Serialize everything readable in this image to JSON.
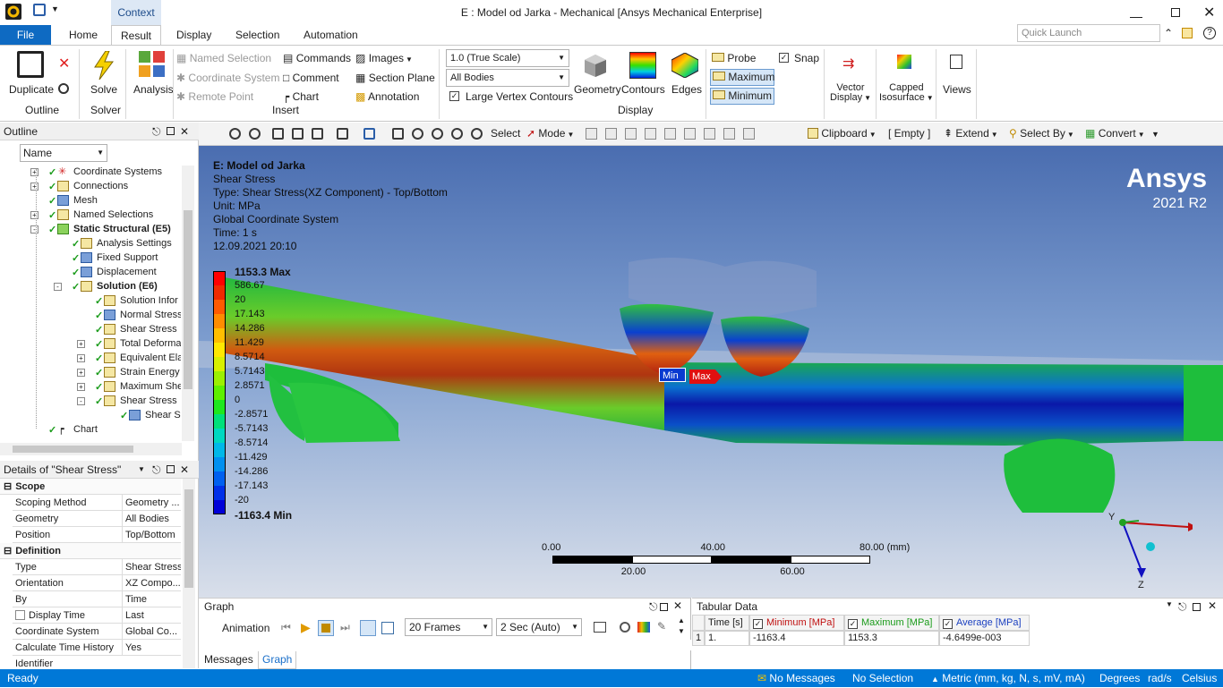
{
  "window": {
    "title": "E : Model od Jarka - Mechanical [Ansys Mechanical Enterprise]"
  },
  "context_label": "Context",
  "tabs": {
    "file": "File",
    "home": "Home",
    "result": "Result",
    "display": "Display",
    "selection": "Selection",
    "automation": "Automation"
  },
  "quick_launch": {
    "placeholder": "Quick Launch"
  },
  "ribbon": {
    "duplicate": "Duplicate",
    "outline_group": "Outline",
    "solve": "Solve",
    "solver_group": "Solver",
    "analysis": "Analysis",
    "named_selection": "Named Selection",
    "coordinate_system": "Coordinate System",
    "remote_point": "Remote Point",
    "commands": "Commands",
    "comment": "Comment",
    "chart": "Chart",
    "images": "Images",
    "section_plane": "Section Plane",
    "annotation": "Annotation",
    "insert_group": "Insert",
    "scale_select": "1.0 (True Scale)",
    "bodies_select": "All Bodies",
    "large_vertex": "Large Vertex Contours",
    "geometry": "Geometry",
    "contours": "Contours",
    "edges": "Edges",
    "display_group": "Display",
    "probe": "Probe",
    "maximum": "Maximum",
    "minimum": "Minimum",
    "snap": "Snap",
    "vector_display_1": "Vector",
    "vector_display_2": "Display",
    "capped_1": "Capped",
    "capped_2": "Isosurface",
    "views": "Views"
  },
  "toolbar2": {
    "select": "Select",
    "mode": "Mode",
    "clipboard": "Clipboard",
    "empty": "[ Empty ]",
    "extend": "Extend",
    "select_by": "Select By",
    "convert": "Convert"
  },
  "outline": {
    "title": "Outline",
    "filter": "Name",
    "items": [
      {
        "label": "Coordinate Systems"
      },
      {
        "label": "Connections"
      },
      {
        "label": "Mesh"
      },
      {
        "label": "Named Selections"
      },
      {
        "label": "Static Structural (E5)"
      },
      {
        "label": "Analysis Settings"
      },
      {
        "label": "Fixed Support"
      },
      {
        "label": "Displacement"
      },
      {
        "label": "Solution (E6)"
      },
      {
        "label": "Solution Infor"
      },
      {
        "label": "Normal Stress"
      },
      {
        "label": "Shear Stress"
      },
      {
        "label": "Total Deforma"
      },
      {
        "label": "Equivalent Ela"
      },
      {
        "label": "Strain Energy"
      },
      {
        "label": "Maximum She"
      },
      {
        "label": "Shear Stress"
      },
      {
        "label": "Shear St"
      },
      {
        "label": "Chart"
      }
    ]
  },
  "details": {
    "title": "Details of \"Shear Stress\"",
    "sections": {
      "scope": "Scope",
      "definition": "Definition"
    },
    "rows": [
      {
        "k": "Scoping Method",
        "v": "Geometry ..."
      },
      {
        "k": "Geometry",
        "v": "All Bodies"
      },
      {
        "k": "Position",
        "v": "Top/Bottom"
      },
      {
        "k": "Type",
        "v": "Shear Stress"
      },
      {
        "k": "Orientation",
        "v": "XZ Compo..."
      },
      {
        "k": "By",
        "v": "Time"
      },
      {
        "k": "Display Time",
        "v": "Last"
      },
      {
        "k": "Coordinate System",
        "v": "Global Co..."
      },
      {
        "k": "Calculate Time History",
        "v": "Yes"
      },
      {
        "k": "Identifier",
        "v": ""
      }
    ]
  },
  "viewport": {
    "info": [
      "E: Model od Jarka",
      "Shear Stress",
      "Type: Shear Stress(XZ Component) - Top/Bottom",
      "Unit: MPa",
      "Global Coordinate System",
      "Time: 1 s",
      "12.09.2021 20:10"
    ],
    "brand": "Ansys",
    "version": "2021 R2",
    "legend": {
      "labels": [
        "1153.3 Max",
        "586.67",
        "20",
        "17.143",
        "14.286",
        "11.429",
        "8.5714",
        "5.7143",
        "2.8571",
        "0",
        "-2.8571",
        "-5.7143",
        "-8.5714",
        "-11.429",
        "-14.286",
        "-17.143",
        "-20",
        "-1163.4 Min"
      ],
      "colors": [
        "#ff0000",
        "#f02a00",
        "#ff5a00",
        "#ff8c00",
        "#ffbe00",
        "#ffe800",
        "#d8f000",
        "#9cf000",
        "#5ef000",
        "#1ee81e",
        "#00e07a",
        "#00d8c0",
        "#00b8e8",
        "#0090f0",
        "#0060f0",
        "#0030e8",
        "#0000d8"
      ]
    },
    "min_label": "Min",
    "max_label": "Max",
    "scale": {
      "top": [
        "0.00",
        "40.00",
        "80.00 (mm)"
      ],
      "bottom": [
        "20.00",
        "60.00"
      ]
    },
    "axes": {
      "y": "Y",
      "z": "Z"
    }
  },
  "graph": {
    "title": "Graph",
    "animation": "Animation",
    "frames": "20 Frames",
    "duration": "2 Sec (Auto)",
    "tab_messages": "Messages",
    "tab_graph": "Graph"
  },
  "tabular": {
    "title": "Tabular Data",
    "headers": [
      "Time [s]",
      "Minimum [MPa]",
      "Maximum [MPa]",
      "Average [MPa]"
    ],
    "rows": [
      [
        "1",
        "1.",
        "-1163.4",
        "1153.3",
        "-4.6499e-003"
      ]
    ]
  },
  "status": {
    "ready": "Ready",
    "messages": "No Messages",
    "selection": "No Selection",
    "units": "Metric (mm, kg, N, s, mV, mA)",
    "angle": "Degrees",
    "rot": "rad/s",
    "temp": "Celsius"
  }
}
